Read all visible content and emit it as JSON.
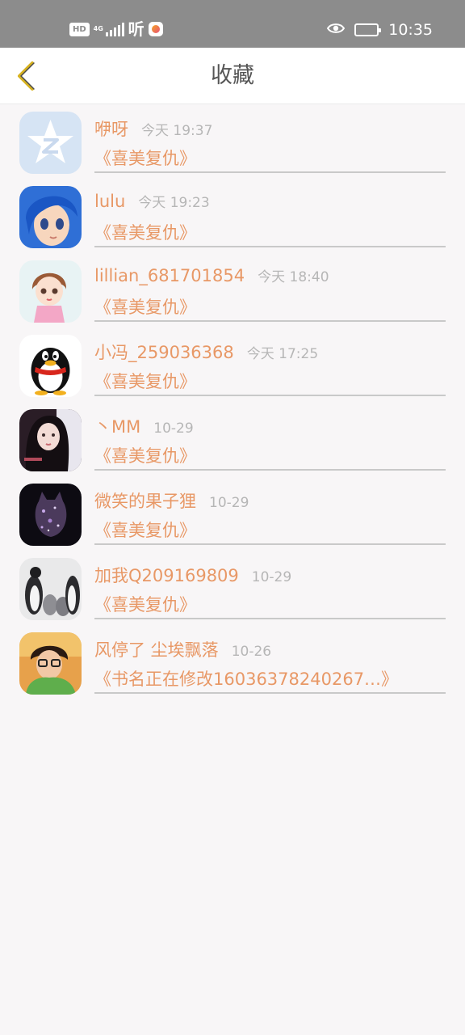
{
  "status_bar": {
    "hd": "HD",
    "network": "4G",
    "listen_text": "听",
    "clock": "10:35",
    "battery_percent": 20,
    "icons": [
      "hd-icon",
      "signal-icon",
      "app-badge-icon",
      "eye-icon",
      "battery-icon"
    ]
  },
  "nav": {
    "title": "收藏",
    "back_icon": "chevron-left-icon",
    "accent": "#d7b21f"
  },
  "colors": {
    "name": "#e89866",
    "time": "#b6b6b6",
    "divider": "#c9c9c9",
    "background": "#f8f6f7"
  },
  "items": [
    {
      "name": "咿呀",
      "time": "今天 19:37",
      "book": "《喜美复仇》",
      "avatar": "qzone-star-avatar"
    },
    {
      "name": "lulu",
      "time": "今天 19:23",
      "book": "《喜美复仇》",
      "avatar": "anime-blue-hair-avatar"
    },
    {
      "name": "lillian_681701854",
      "time": "今天 18:40",
      "book": "《喜美复仇》",
      "avatar": "cartoon-girl-avatar"
    },
    {
      "name": "小冯_259036368",
      "time": "今天 17:25",
      "book": "《喜美复仇》",
      "avatar": "qq-penguin-avatar"
    },
    {
      "name": "丶MM",
      "time": "10-29",
      "book": "《喜美复仇》",
      "avatar": "photo-girl-avatar"
    },
    {
      "name": "微笑的果子狸",
      "time": "10-29",
      "book": "《喜美复仇》",
      "avatar": "galaxy-cat-avatar"
    },
    {
      "name": "加我Q209169809",
      "time": "10-29",
      "book": "《喜美复仇》",
      "avatar": "penguins-photo-avatar"
    },
    {
      "name": "风停了 尘埃飘落",
      "time": "10-26",
      "book": "《书名正在修改16036378240267…》",
      "avatar": "boy-glasses-avatar"
    }
  ]
}
